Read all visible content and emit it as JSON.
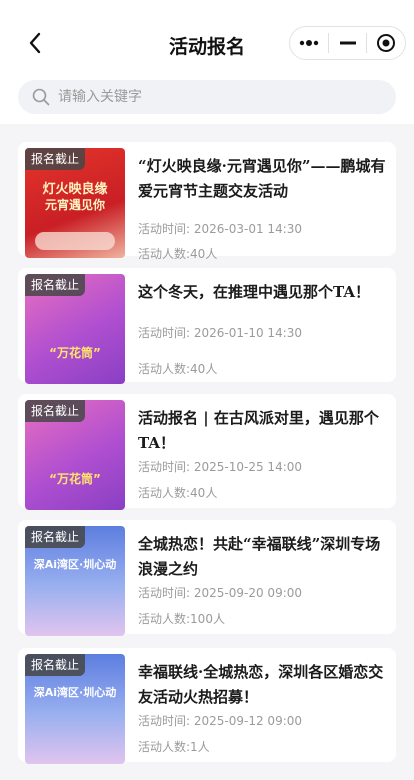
{
  "header": {
    "title": "活动报名",
    "back_icon": "chevron-left-icon",
    "more_icon": "more-dots-icon",
    "minimize_icon": "minus-icon",
    "close_icon": "target-circle-icon"
  },
  "search": {
    "placeholder": "请输入关键字",
    "icon": "search-icon"
  },
  "activities": [
    {
      "badge": "报名截止",
      "title": "“灯火映良缘·元宵遇见你”——鹏城有爱元宵节主题交友活动",
      "time_label": "活动时间:",
      "time": "2026-03-01 14:30",
      "count_label": "活动人数:",
      "count": "40人",
      "thumb_text_1": "灯火映良缘",
      "thumb_text_2": "元宵遇见你",
      "thumb_color": "#d7282d"
    },
    {
      "badge": "报名截止",
      "title": "这个冬天，在推理中遇见那个TA！",
      "time_label": "活动时间:",
      "time": "2026-01-10 14:30",
      "count_label": "活动人数:",
      "count": "40人",
      "thumb_text_1": "“万花筒”",
      "thumb_text_2": "",
      "thumb_color": "#c46ad6"
    },
    {
      "badge": "报名截止",
      "title": "活动报名 | 在古风派对里，遇见那个TA！",
      "time_label": "活动时间:",
      "time": "2025-10-25 14:00",
      "count_label": "活动人数:",
      "count": "40人",
      "thumb_text_1": "“万花筒”",
      "thumb_text_2": "",
      "thumb_color": "#c46ad6"
    },
    {
      "badge": "报名截止",
      "title": "全城热恋！共赴“幸福联线”深圳专场浪漫之约",
      "time_label": "活动时间:",
      "time": "2025-09-20 09:00",
      "count_label": "活动人数:",
      "count": "100人",
      "thumb_text_1": "深Ai湾区·圳心动",
      "thumb_text_2": "",
      "thumb_color": "#6f86e0"
    },
    {
      "badge": "报名截止",
      "title": "幸福联线·全城热恋，深圳各区婚恋交友活动火热招募！",
      "time_label": "活动时间:",
      "time": "2025-09-12 09:00",
      "count_label": "活动人数:",
      "count": "1人",
      "thumb_text_1": "深Ai湾区·圳心动",
      "thumb_text_2": "",
      "thumb_color": "#6f86e0"
    }
  ]
}
